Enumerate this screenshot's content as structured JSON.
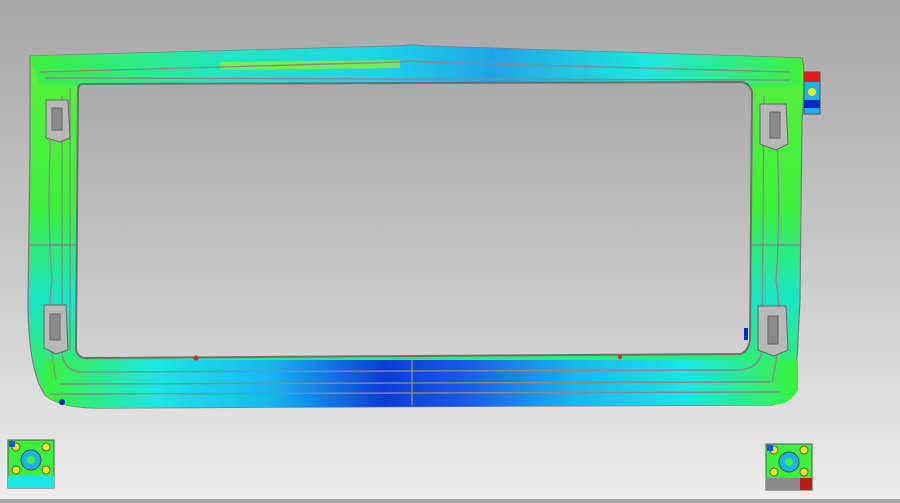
{
  "scene": {
    "background_top": "#a6a6a6",
    "background_bottom": "#ececec",
    "model": "rectangular-frame-contour",
    "colors": {
      "green": "#3cf03c",
      "lime": "#7cf02a",
      "cyan": "#19e6e6",
      "blue": "#1a55e8",
      "deep_blue": "#0a28c8",
      "red": "#e01e1e",
      "yellow": "#f0e61e",
      "edge_gray": "#8a8a8a"
    }
  }
}
